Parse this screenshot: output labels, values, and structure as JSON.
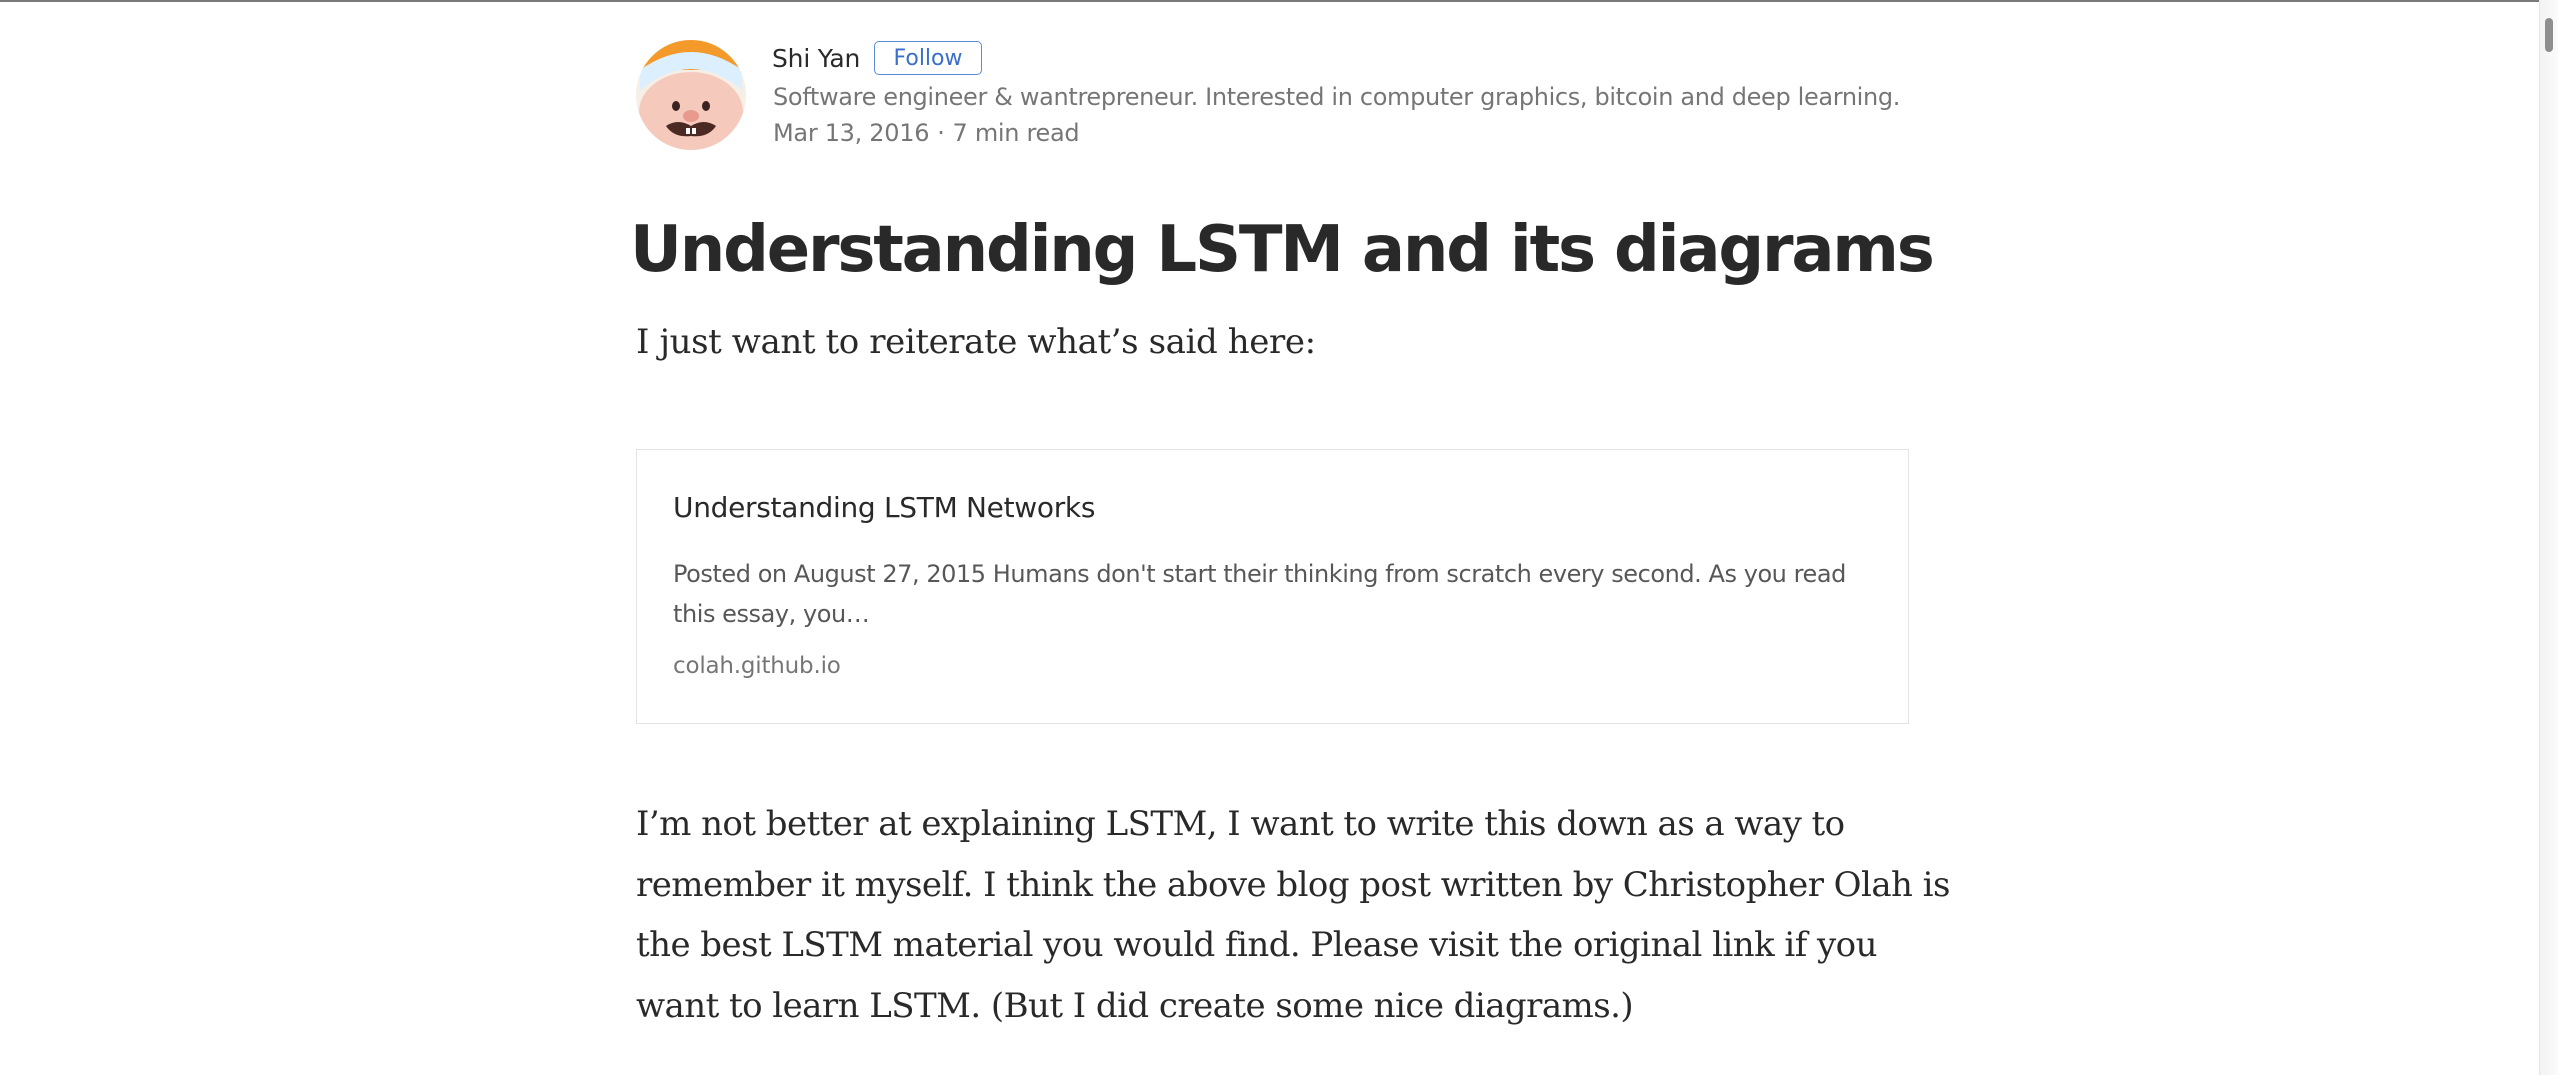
{
  "author": {
    "name": "Shi Yan",
    "follow_label": "Follow",
    "bio": "Software engineer & wantrepreneur. Interested in computer graphics, bitcoin and deep learning.",
    "date": "Mar 13, 2016",
    "separator": "·",
    "read_time": "7 min read"
  },
  "post": {
    "title": "Understanding LSTM and its diagrams",
    "intro": "I just want to reiterate what’s said here:",
    "body_lines": [
      "I’m not better at explaining LSTM, I want to write this down as a way to",
      "remember it myself. I think the above blog post written by Christopher Olah is",
      "the best LSTM material you would find. Please visit the original link if you",
      "want to learn LSTM. (But I did create some nice diagrams.)"
    ]
  },
  "link_card": {
    "title": "Understanding LSTM Networks",
    "description": "Posted on August 27, 2015 Humans don't start their thinking from scratch every second. As you read this essay, you…",
    "domain": "colah.github.io"
  },
  "colors": {
    "follow_accent": "#3b6fc9",
    "avatar_hat": "#f39a2b"
  },
  "icons": {
    "avatar": "cartoon-face-avatar"
  }
}
